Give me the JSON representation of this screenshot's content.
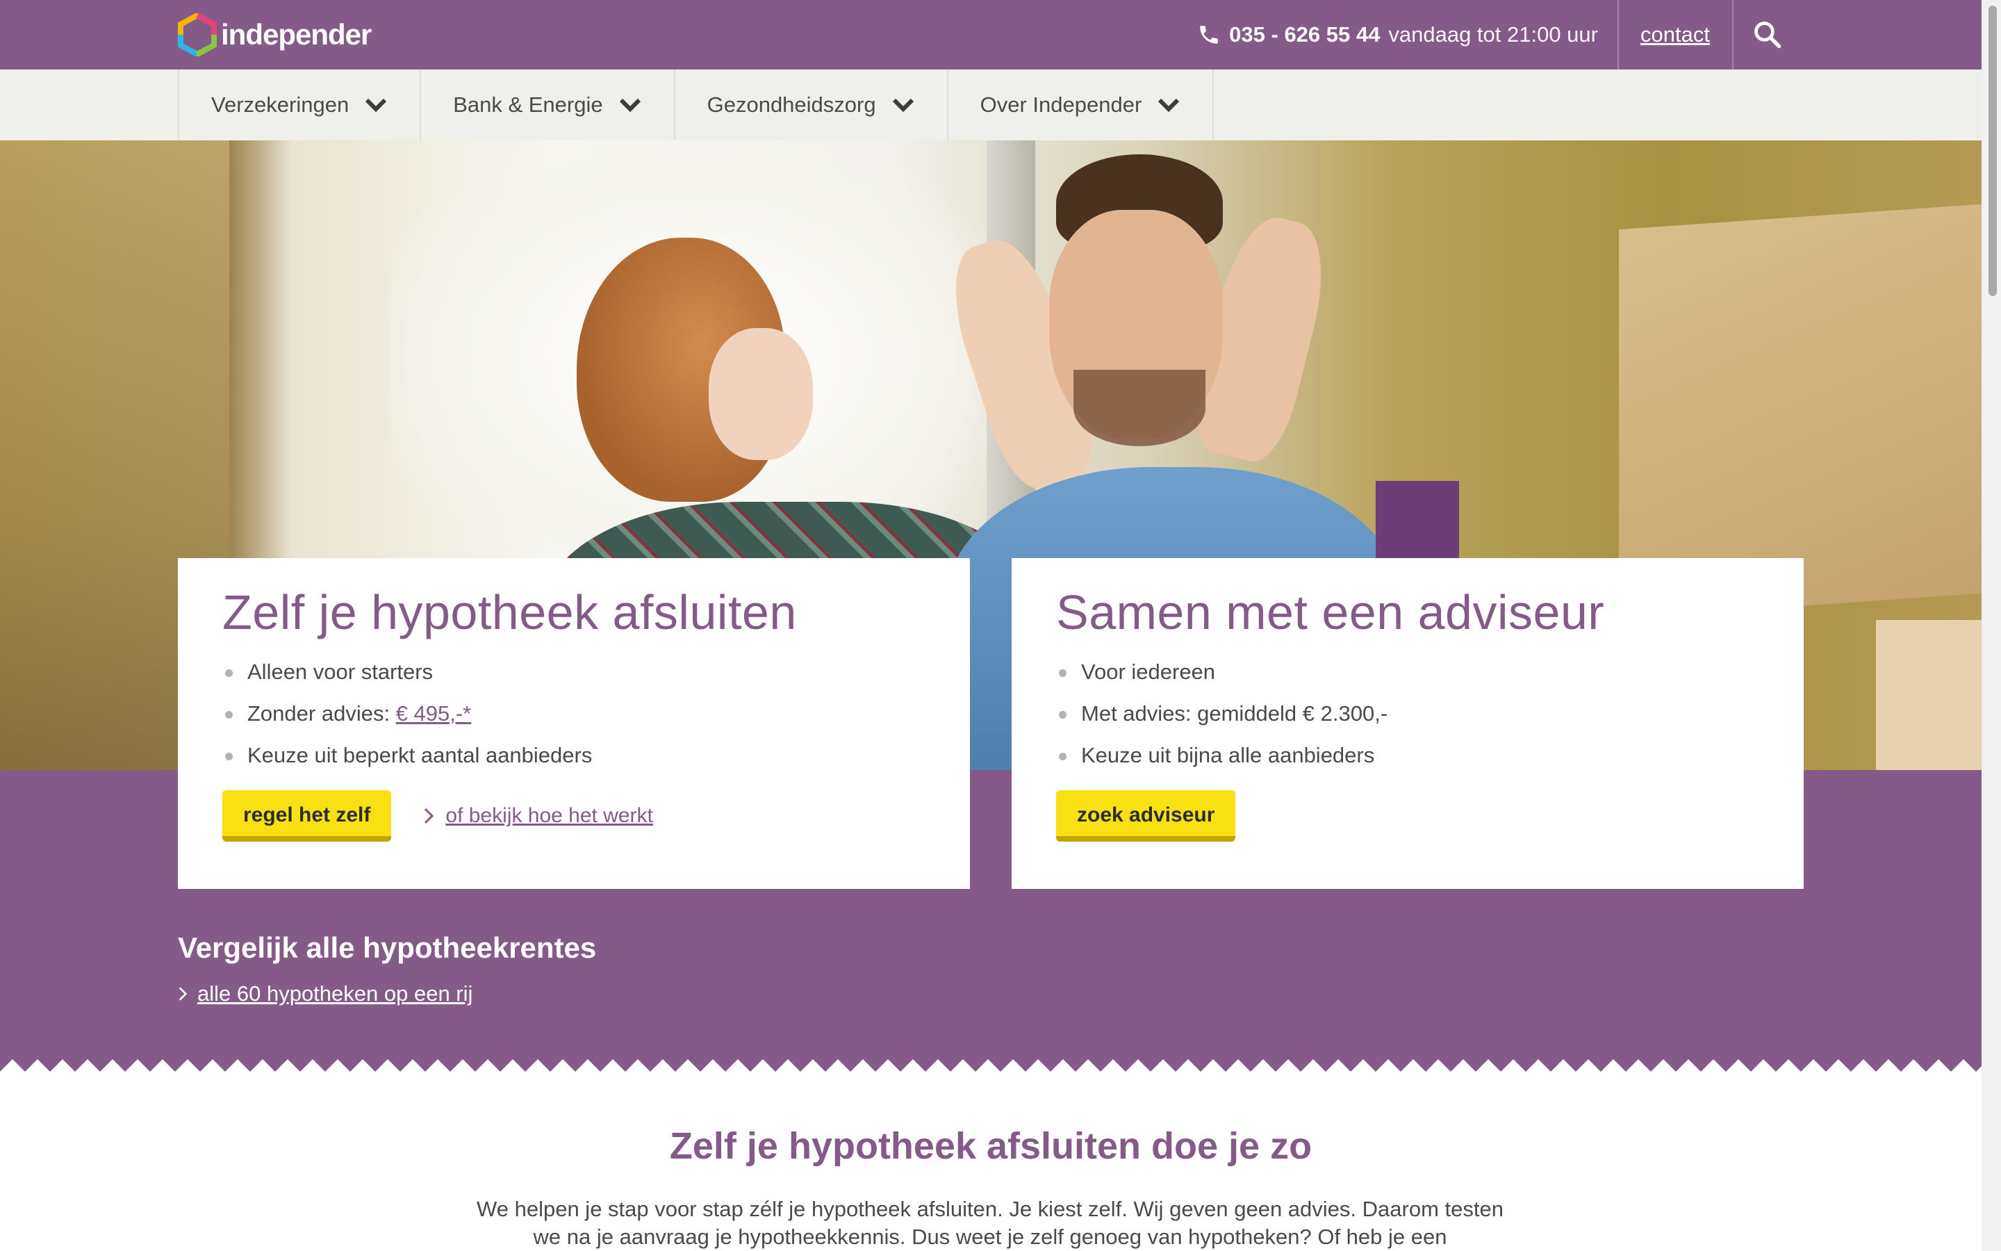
{
  "brand": {
    "name": "independer"
  },
  "topbar": {
    "phone_number": "035 - 626 55 44",
    "phone_hours": "vandaag tot 21:00 uur",
    "contact_label": "contact",
    "search_icon": "search-icon"
  },
  "nav": {
    "items": [
      {
        "label": "Verzekeringen"
      },
      {
        "label": "Bank & Energie"
      },
      {
        "label": "Gezondheidszorg"
      },
      {
        "label": "Over Independer"
      }
    ]
  },
  "cards": [
    {
      "title": "Zelf je hypotheek afsluiten",
      "bullets": [
        "Alleen voor starters",
        "Zonder advies: ",
        "Keuze uit beperkt aantal aanbieders"
      ],
      "price_link": "€ 495,-*",
      "button": "regel het zelf",
      "secondary_link": " of bekijk hoe het werkt"
    },
    {
      "title": "Samen met een adviseur",
      "bullets": [
        "Voor iedereen",
        "Met advies: gemiddeld € 2.300,-",
        "Keuze uit bijna alle aanbieders"
      ],
      "button": "zoek adviseur"
    }
  ],
  "compare": {
    "title": "Vergelijk alle hypotheekrentes",
    "link": "alle 60 hypotheken op een rij"
  },
  "intro": {
    "title": "Zelf je hypotheek afsluiten doe je zo",
    "text": "We helpen je stap voor stap zélf je hypotheek afsluiten. Je kiest zelf. Wij geven geen advies. Daarom testen we na je aanvraag je hypotheekkennis. Dus weet je zelf genoeg van hypotheken? Of heb je een"
  },
  "colors": {
    "brand_purple": "#845b88",
    "button_yellow": "#f9e010",
    "nav_background": "#efefec"
  }
}
